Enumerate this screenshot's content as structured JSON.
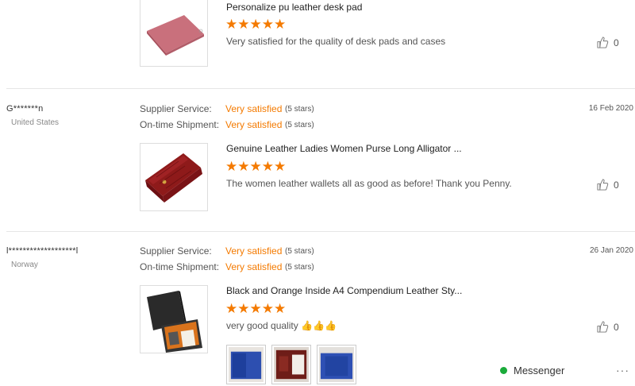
{
  "reviews": [
    {
      "product_title": "Personalize pu leather desk pad",
      "stars": "★★★★★",
      "comment": "Very satisfied for the quality of desk pads and cases",
      "likes": "0"
    },
    {
      "buyer": "G*******n",
      "country": "United States",
      "date": "16 Feb 2020",
      "supplier_label": "Supplier Service:",
      "supplier_value": "Very satisfied",
      "supplier_stars": "(5 stars)",
      "shipment_label": "On-time Shipment:",
      "shipment_value": "Very satisfied",
      "shipment_stars": "(5 stars)",
      "product_title": "Genuine Leather Ladies Women Purse Long Alligator ...",
      "stars": "★★★★★",
      "comment": "The women leather wallets all as good as before! Thank you Penny.",
      "likes": "0"
    },
    {
      "buyer": "l*******************l",
      "country": "Norway",
      "date": "26 Jan 2020",
      "supplier_label": "Supplier Service:",
      "supplier_value": "Very satisfied",
      "supplier_stars": "(5 stars)",
      "shipment_label": "On-time Shipment:",
      "shipment_value": "Very satisfied",
      "shipment_stars": "(5 stars)",
      "product_title": "Black and Orange Inside A4 Compendium Leather Sty...",
      "stars": "★★★★★",
      "comment": "very good quality 👍👍👍",
      "likes": "0"
    }
  ],
  "messenger": {
    "label": "Messenger",
    "more": "···"
  },
  "colors": {
    "accent": "#f47a00",
    "online": "#1aab3a"
  }
}
